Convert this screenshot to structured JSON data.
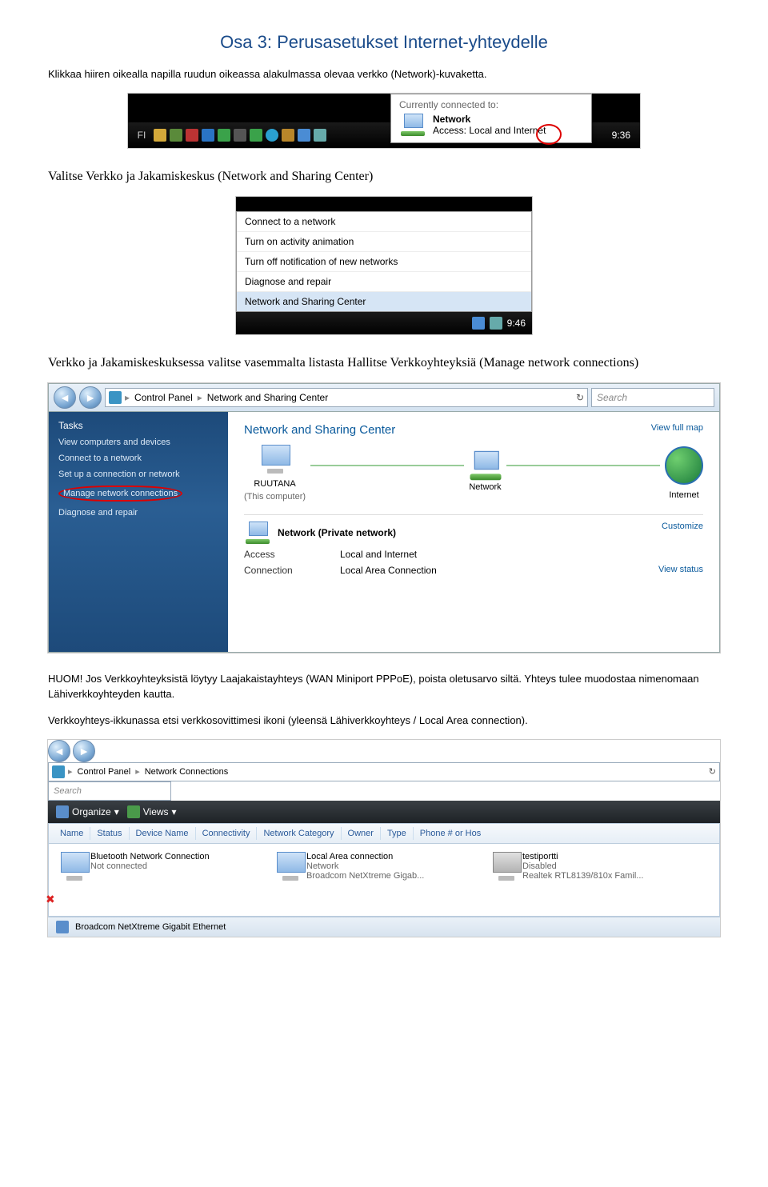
{
  "heading": "Osa 3: Perusasetukset Internet-yhteydelle",
  "para1": "Klikkaa hiiren oikealla napilla ruudun oikeassa alakulmassa olevaa verkko (Network)-kuvaketta.",
  "para2": "Valitse Verkko ja Jakamiskeskus (Network and Sharing Center)",
  "para3": "Verkko ja Jakamiskeskuksessa valitse vasemmalta listasta Hallitse Verkkoyhteyksiä (Manage network connections)",
  "para4a": "HUOM! Jos Verkkoyhteyksistä löytyy Laajakaistayhteys (WAN Miniport PPPoE), poista oletusarvo siltä. Yhteys tulee muodostaa nimenomaan Lähiverkkoyhteyden kautta.",
  "para4b": "Verkkoyhteys-ikkunassa etsi verkkosovittimesi ikoni (yleensä Lähiverkkoyhteys / Local Area connection).",
  "ss1": {
    "tooltip_hdr": "Currently connected to:",
    "tooltip_name": "Network",
    "tooltip_access": "Access:   Local and Internet",
    "lang": "FI",
    "clock": "9:36"
  },
  "ss2": {
    "i1": "Connect to a network",
    "i2": "Turn on activity animation",
    "i3": "Turn off notification of new networks",
    "i4": "Diagnose and repair",
    "i5": "Network and Sharing Center",
    "clock": "9:46"
  },
  "ss3": {
    "crumb1": "Control Panel",
    "crumb2": "Network and Sharing Center",
    "search": "Search",
    "side_hd": "Tasks",
    "s1": "View computers and devices",
    "s2": "Connect to a network",
    "s3": "Set up a connection or network",
    "s4": "Manage network connections",
    "s5": "Diagnose and repair",
    "main_h": "Network and Sharing Center",
    "viewmap": "View full map",
    "node1": "RUUTANA",
    "node1sub": "(This computer)",
    "node2": "Network",
    "node3": "Internet",
    "sec_name": "Network (Private network)",
    "customize": "Customize",
    "s_access_l": "Access",
    "s_access_v": "Local and Internet",
    "s_conn_l": "Connection",
    "s_conn_v": "Local Area Connection",
    "viewstatus": "View status"
  },
  "ss4": {
    "crumb1": "Control Panel",
    "crumb2": "Network Connections",
    "search": "Search",
    "organize": "Organize",
    "views": "Views",
    "cols": [
      "Name",
      "Status",
      "Device Name",
      "Connectivity",
      "Network Category",
      "Owner",
      "Type",
      "Phone # or Hos"
    ],
    "c1_t1": "Bluetooth Network Connection",
    "c1_t2": "Not connected",
    "c2_t1": "Local Area connection",
    "c2_t2": "Network",
    "c2_t3": "Broadcom NetXtreme Gigab...",
    "c3_t1": "testiportti",
    "c3_t2": "Disabled",
    "c3_t3": "Realtek RTL8139/810x Famil...",
    "status": "Broadcom NetXtreme Gigabit Ethernet"
  }
}
